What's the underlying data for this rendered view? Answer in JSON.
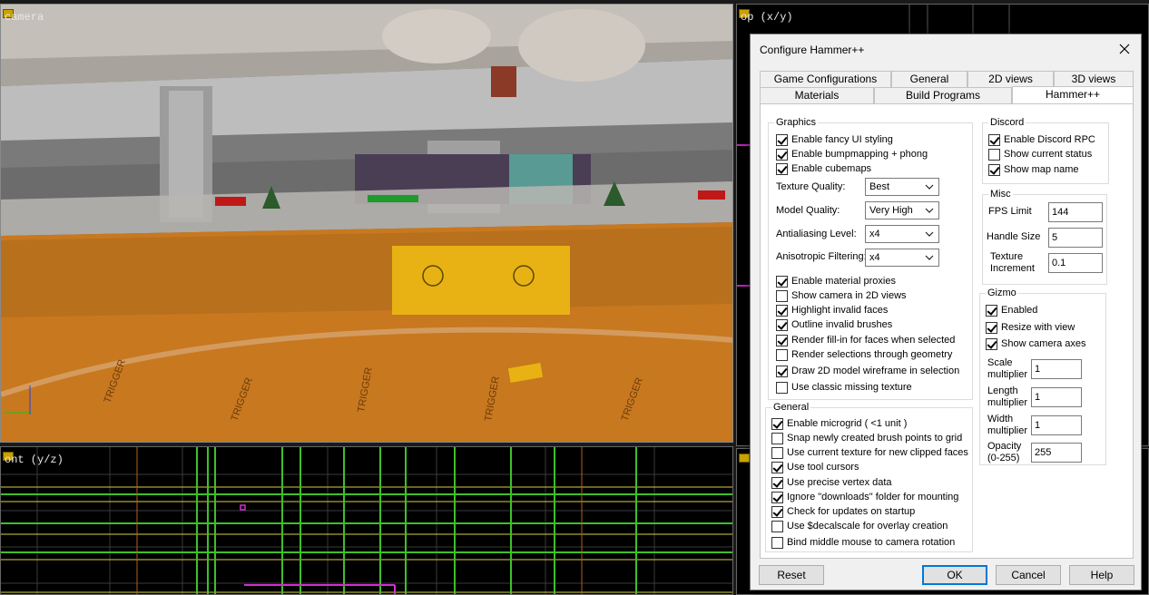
{
  "viewports": {
    "camera_label": "camera",
    "top_label": "op (x/y)",
    "front_label": "ont (y/z)",
    "side_label": ""
  },
  "scene": {
    "trigger_text": "TRIGGER",
    "accent_orange": "#c8781e",
    "grid_green": "#3fbf2a",
    "grid_yellow": "#d8d040"
  },
  "dialog": {
    "title": "Configure Hammer++",
    "close_icon": "close-icon",
    "tabs_row1": [
      "Game Configurations",
      "General",
      "2D views",
      "3D views"
    ],
    "tabs_row2": [
      "Materials",
      "Build Programs",
      "Hammer++"
    ],
    "active_tab": "Hammer++",
    "graphics": {
      "title": "Graphics",
      "top_checks": [
        {
          "label": "Enable fancy UI styling",
          "checked": true
        },
        {
          "label": "Enable bumpmapping + phong",
          "checked": true
        },
        {
          "label": "Enable cubemaps",
          "checked": true
        }
      ],
      "texture_quality_label": "Texture Quality:",
      "texture_quality": "Best",
      "model_quality_label": "Model Quality:",
      "model_quality": "Very High",
      "antialiasing_label": "Antialiasing Level:",
      "antialiasing": "x4",
      "anisotropic_label": "Anisotropic Filtering:",
      "anisotropic": "x4",
      "bottom_checks": [
        {
          "label": "Enable material proxies",
          "checked": true
        },
        {
          "label": "Show camera in 2D views",
          "checked": false
        },
        {
          "label": "Highlight invalid faces",
          "checked": true
        },
        {
          "label": "Outline invalid brushes",
          "checked": true
        },
        {
          "label": "Render fill-in for faces when selected",
          "checked": true
        },
        {
          "label": "Render selections through geometry",
          "checked": false
        },
        {
          "label": "Draw 2D model wireframe in selection",
          "checked": true
        },
        {
          "label": "Use classic missing texture",
          "checked": false
        }
      ]
    },
    "general": {
      "title": "General",
      "checks": [
        {
          "label": "Enable microgrid ( <1 unit )",
          "checked": true
        },
        {
          "label": "Snap newly created brush points to grid",
          "checked": false
        },
        {
          "label": "Use current texture for new clipped faces",
          "checked": false
        },
        {
          "label": "Use tool cursors",
          "checked": true
        },
        {
          "label": "Use precise vertex data",
          "checked": true
        },
        {
          "label": "Ignore \"downloads\" folder for mounting",
          "checked": true
        },
        {
          "label": "Check for updates on startup",
          "checked": true
        },
        {
          "label": "Use $decalscale for overlay creation",
          "checked": false
        },
        {
          "label": "Bind middle mouse to camera rotation",
          "checked": false
        }
      ]
    },
    "discord": {
      "title": "Discord",
      "checks": [
        {
          "label": "Enable Discord RPC",
          "checked": true
        },
        {
          "label": "Show current status",
          "checked": false
        },
        {
          "label": "Show map name",
          "checked": true
        }
      ]
    },
    "misc": {
      "title": "Misc",
      "fps_label": "FPS Limit",
      "fps_value": "144",
      "handle_label": "Handle Size",
      "handle_value": "5",
      "texinc_label_1": "Texture",
      "texinc_label_2": "Increment",
      "texinc_value": "0.1"
    },
    "gizmo": {
      "title": "Gizmo",
      "checks": [
        {
          "label": "Enabled",
          "checked": true
        },
        {
          "label": "Resize with view",
          "checked": true
        },
        {
          "label": "Show camera axes",
          "checked": true
        }
      ],
      "scale_label_1": "Scale",
      "scale_label_2": "multiplier",
      "scale_value": "1",
      "length_label_1": "Length",
      "length_label_2": "multiplier",
      "length_value": "1",
      "width_label_1": "Width",
      "width_label_2": "multiplier",
      "width_value": "1",
      "opacity_label_1": "Opacity",
      "opacity_label_2": "(0-255)",
      "opacity_value": "255"
    },
    "buttons": {
      "reset": "Reset",
      "ok": "OK",
      "cancel": "Cancel",
      "help": "Help"
    }
  }
}
